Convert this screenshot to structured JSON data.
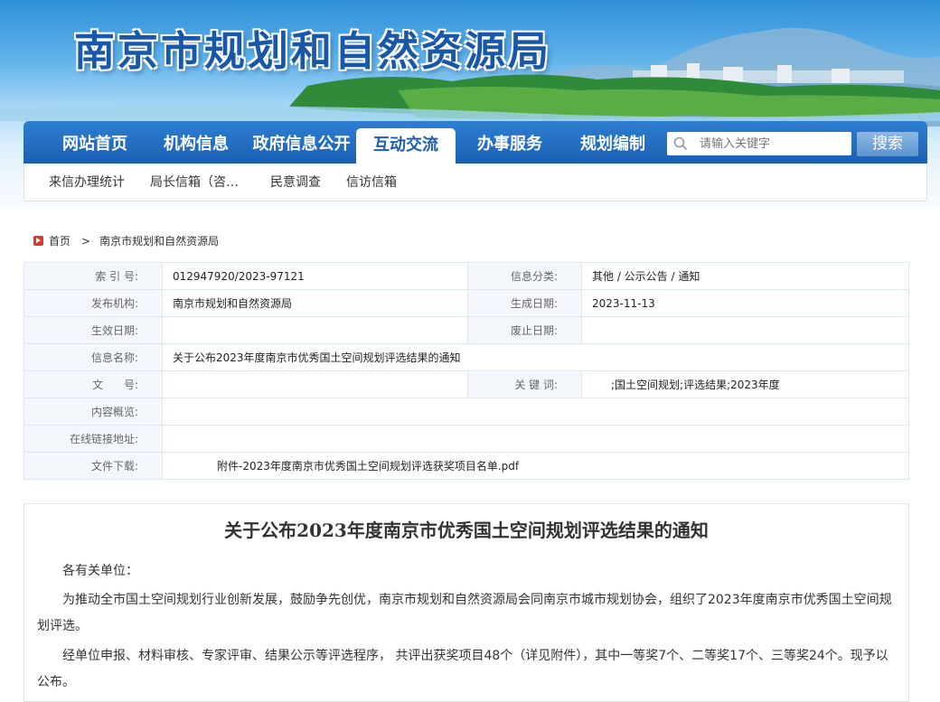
{
  "site": {
    "title": "南京市规划和自然资源局"
  },
  "nav": {
    "items": [
      {
        "label": "网站首页"
      },
      {
        "label": "机构信息"
      },
      {
        "label": "政府信息公开"
      },
      {
        "label": "互动交流",
        "active": true
      },
      {
        "label": "办事服务"
      },
      {
        "label": "规划编制"
      }
    ],
    "search_placeholder": "请输入关键字",
    "search_button": "搜索"
  },
  "subnav": {
    "items": [
      "来信办理统计",
      "局长信箱（咨…",
      "民意调查",
      "信访信箱"
    ]
  },
  "breadcrumb": {
    "home": "首页",
    "current": "南京市规划和自然资源局"
  },
  "info": {
    "index_label": "索 引 号:",
    "index_value": "012947920/2023-97121",
    "category_label": "信息分类:",
    "category_value": "其他 / 公示公告 / 通知",
    "publisher_label": "发布机构:",
    "publisher_value": "南京市规划和自然资源局",
    "created_label": "生成日期:",
    "created_value": "2023-11-13",
    "effective_label": "生效日期:",
    "effective_value": "",
    "abolish_label": "废止日期:",
    "abolish_value": "",
    "name_label": "信息名称:",
    "name_value": "关于公布2023年度南京市优秀国土空间规划评选结果的通知",
    "docno_label": "文      号:",
    "docno_value": "",
    "keywords_label": "关 键 词:",
    "keywords_value": ";国土空间规划;评选结果;2023年度",
    "summary_label": "内容概览:",
    "summary_value": "",
    "link_label": "在线链接地址:",
    "link_value": "",
    "download_label": "文件下载:",
    "download_value": "附件-2023年度南京市优秀国土空间规划评选获奖项目名单.pdf"
  },
  "article": {
    "title": "关于公布2023年度南京市优秀国土空间规划评选结果的通知",
    "p1": "各有关单位：",
    "p2": "为推动全市国土空间规划行业创新发展，鼓励争先创优，南京市规划和自然资源局会同南京市城市规划协会，组织了2023年度南京市优秀国土空间规划评选。",
    "p3": "经单位申报、材料审核、专家评审、结果公示等评选程序， 共评出获奖项目48个（详见附件），其中一等奖7个、二等奖17个、三等奖24个。现予以公布。"
  },
  "colors": {
    "nav_blue": "#1a5fb3",
    "title_blue": "#1957a8",
    "accent_red": "#d63b2f"
  },
  "icons": {
    "search": "search-icon",
    "home": "home-icon"
  }
}
